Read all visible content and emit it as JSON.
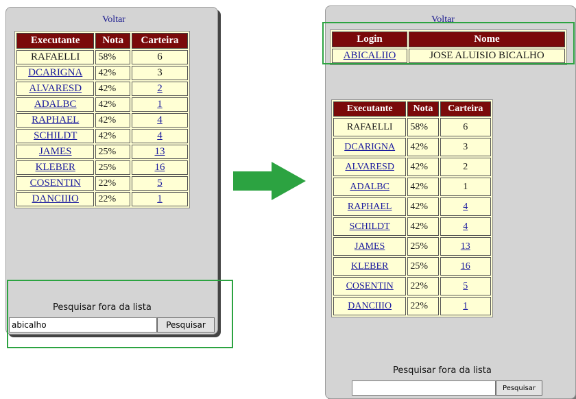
{
  "left": {
    "voltar": "Voltar",
    "columns": [
      "Executante",
      "Nota",
      "Carteira"
    ],
    "rows": [
      [
        "RAFAELLI",
        "58%",
        "6"
      ],
      [
        "DCARIGNA",
        "42%",
        "3"
      ],
      [
        "ALVARESD",
        "42%",
        "2"
      ],
      [
        "ADALBC",
        "42%",
        "1"
      ],
      [
        "RAPHAEL",
        "42%",
        "4"
      ],
      [
        "SCHILDT",
        "42%",
        "4"
      ],
      [
        "JAMES",
        "25%",
        "13"
      ],
      [
        "KLEBER",
        "25%",
        "16"
      ],
      [
        "COSENTIN",
        "22%",
        "5"
      ],
      [
        "DANCIIIO",
        "22%",
        "1"
      ]
    ],
    "search_label": "Pesquisar fora da lista",
    "search_value": "abicalho",
    "search_button": "Pesquisar"
  },
  "right": {
    "voltar": "Voltar",
    "login_columns": [
      "Login",
      "Nome"
    ],
    "login_row": [
      "ABICALIIO",
      "JOSE ALUISIO BICALHO"
    ],
    "columns": [
      "Executante",
      "Nota",
      "Carteira"
    ],
    "rows": [
      [
        "RAFAELLI",
        "58%",
        "6"
      ],
      [
        "DCARIGNA",
        "42%",
        "3"
      ],
      [
        "ALVARESD",
        "42%",
        "2"
      ],
      [
        "ADALBC",
        "42%",
        "1"
      ],
      [
        "RAPHAEL",
        "42%",
        "4"
      ],
      [
        "SCHILDT",
        "42%",
        "4"
      ],
      [
        "JAMES",
        "25%",
        "13"
      ],
      [
        "KLEBER",
        "25%",
        "16"
      ],
      [
        "COSENTIN",
        "22%",
        "5"
      ],
      [
        "DANCIIIO",
        "22%",
        "1"
      ]
    ],
    "search_label": "Pesquisar fora da lista",
    "search_value": "",
    "search_button": "Pesquisar"
  },
  "colors": {
    "header_bg": "#7a0a0a",
    "cell_bg": "#ffffd4",
    "highlight": "#2ca341",
    "arrow": "#2ca341"
  }
}
